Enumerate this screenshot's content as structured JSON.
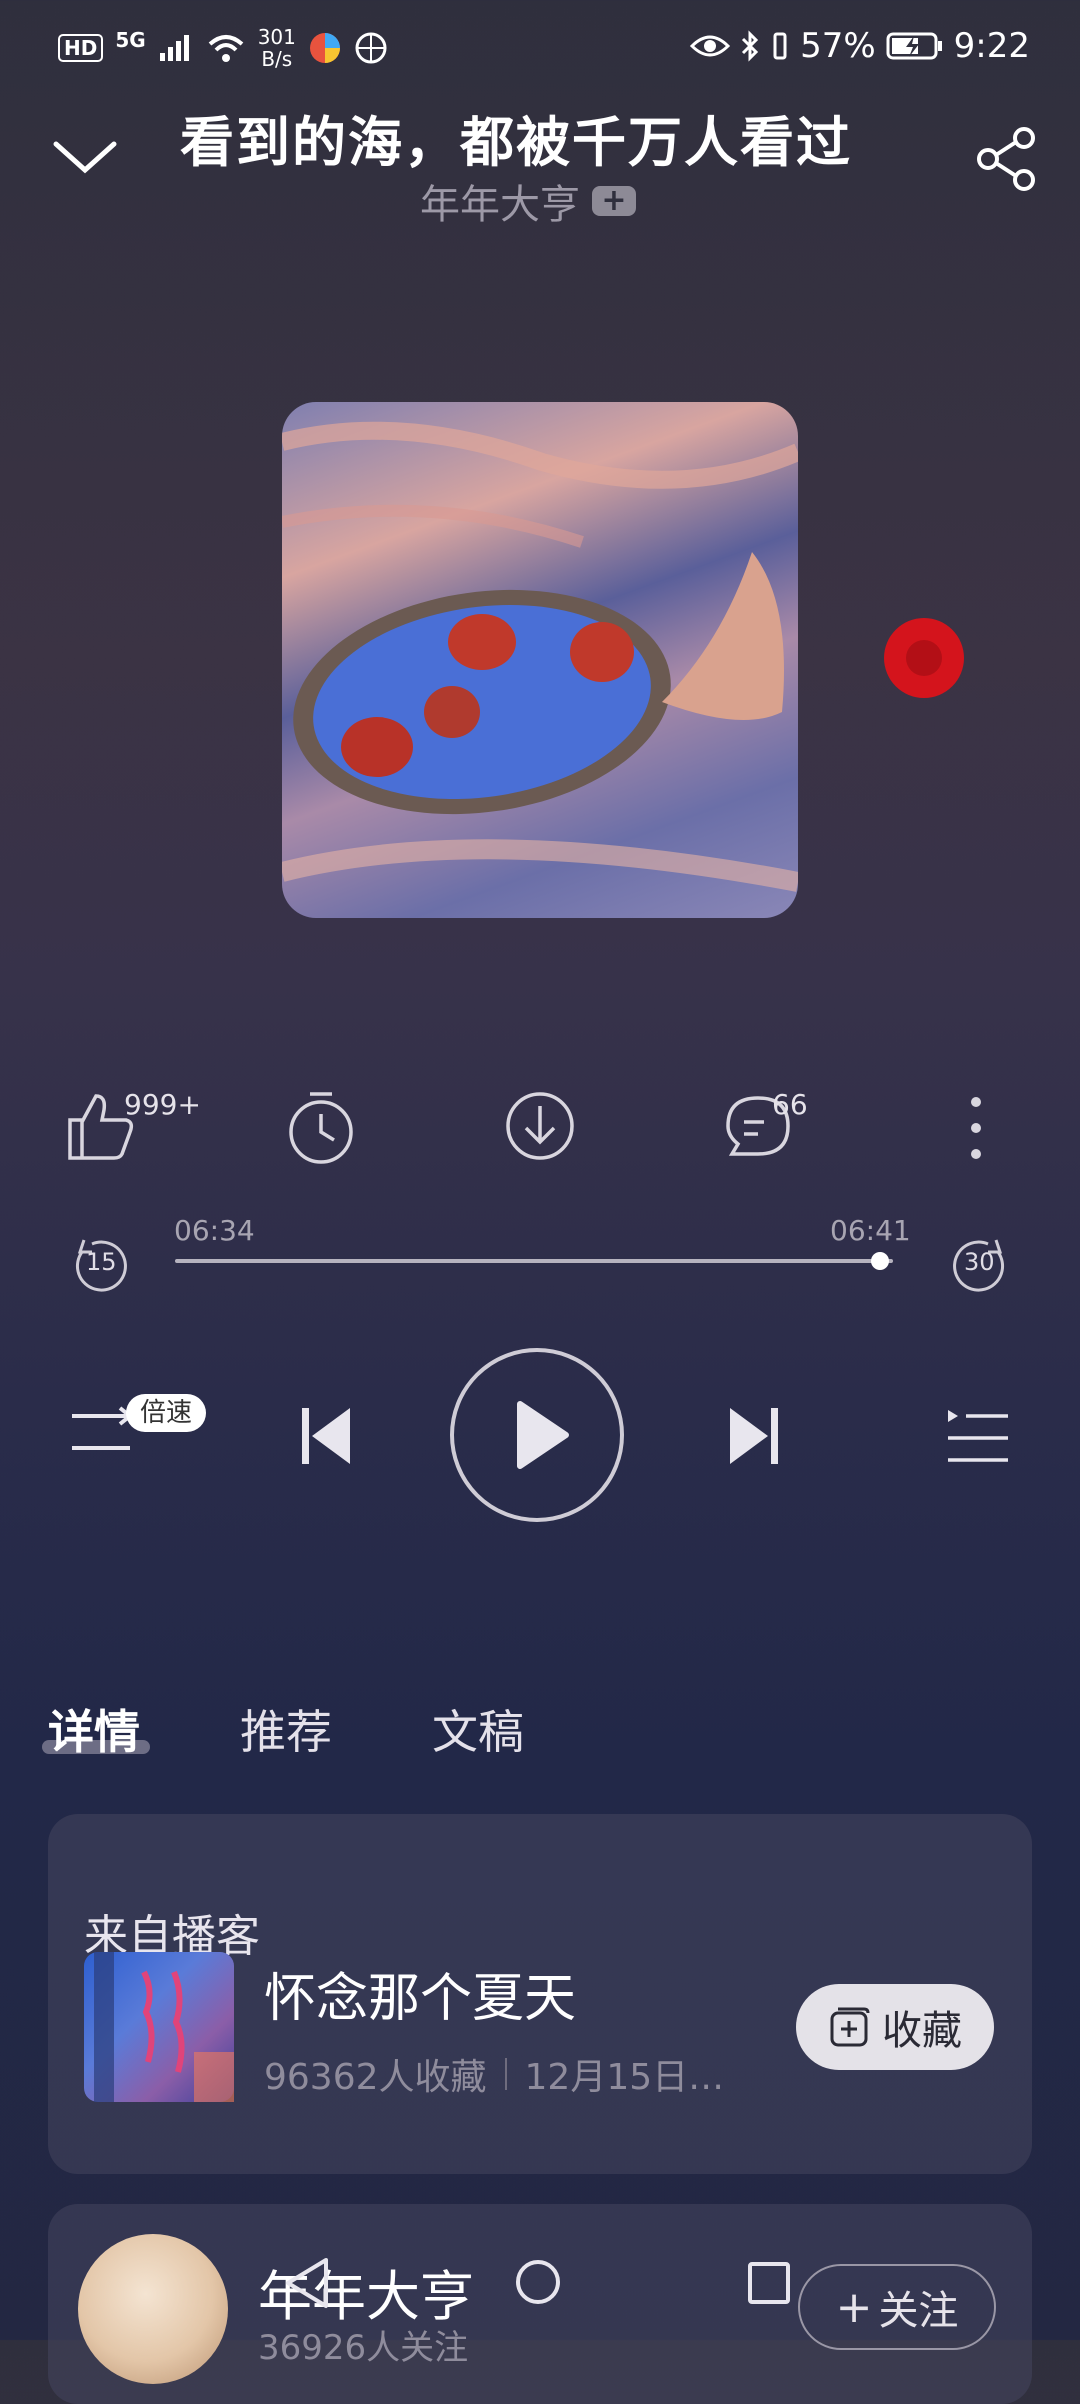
{
  "status_bar": {
    "hd": "HD",
    "network": "5G",
    "speed_value": "301",
    "speed_unit": "B/s",
    "battery": "57%",
    "time": "9:22"
  },
  "header": {
    "title": "看到的海，都被千万人看过",
    "artist": "年年大亨",
    "follow_plus": "+"
  },
  "actions": {
    "like_count": "999+",
    "comment_count": "66"
  },
  "progress": {
    "current": "06:34",
    "total": "06:41",
    "fraction": 0.982,
    "rewind_seconds": "15",
    "forward_seconds": "30"
  },
  "controls": {
    "speed_label": "倍速"
  },
  "tabs": [
    {
      "label": "详情",
      "active": true
    },
    {
      "label": "推荐",
      "active": false
    },
    {
      "label": "文稿",
      "active": false
    }
  ],
  "podcast_card": {
    "section_label": "来自播客",
    "name": "怀念那个夏天",
    "favorites": "96362人收藏",
    "date": "12月15日…",
    "collect_label": "收藏"
  },
  "author_card": {
    "name": "年年大亨",
    "followers": "36926人关注",
    "follow_label": "关注"
  },
  "colors": {
    "record_red": "#d4141c",
    "background_top": "#2f2f3d",
    "background_bottom": "#232742"
  }
}
